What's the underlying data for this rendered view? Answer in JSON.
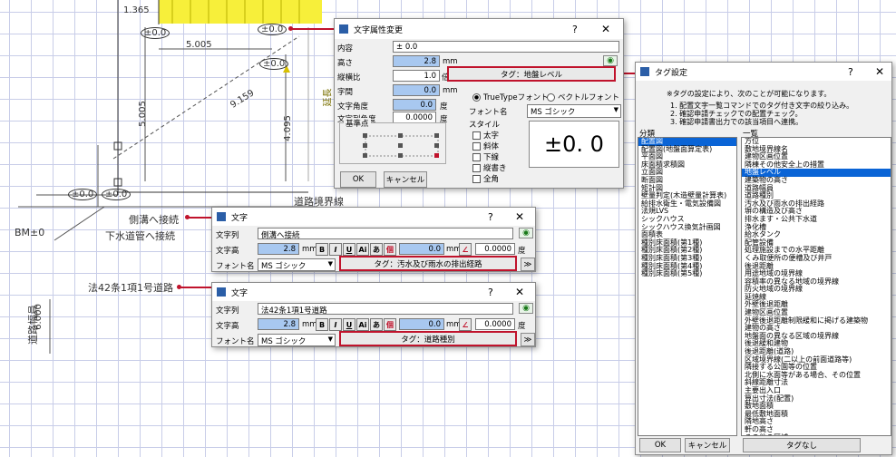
{
  "cad": {
    "texts": {
      "dim_top": "1.365",
      "pm_top": "±0.0",
      "pm_mid": "±0.0",
      "dim_5005": "5.005",
      "dim_5005v": "5.005",
      "dim_9159": "9.159",
      "dim_4095": "4.095",
      "pm_left1": "±0.0",
      "pm_left2": "±0.0",
      "road_boundary": "道路境界線",
      "side_ditch": "側溝へ接続",
      "sewer": "下水道管へ接続",
      "bm": "BM±0",
      "road_law": "法42条1項1号道路",
      "road_width_label": "道路幅員",
      "road_width_value": "6.000",
      "yellow_label1": "延長",
      "yellow_label2": "境"
    }
  },
  "main_dialog": {
    "title": "文字属性変更",
    "help": "?",
    "close": "✕",
    "content_label": "内容",
    "content_value": "± 0.0",
    "height_label": "高さ",
    "height_value": "2.8",
    "height_unit": "mm",
    "aspect_label": "縦横比",
    "aspect_value": "1.0",
    "aspect_unit": "倍",
    "spacing_label": "字間",
    "spacing_value": "0.0",
    "spacing_unit": "mm",
    "angle_label": "文字角度",
    "angle_value": "0.0",
    "angle_unit": "度",
    "line_angle_label": "文字列角度",
    "line_angle_value": "0.0000",
    "line_angle_unit": "度",
    "tag_button": "タグ：地盤レベル",
    "radio_truetype": "TrueTypeフォント",
    "radio_vector": "ベクトルフォント",
    "font_label": "フォント名",
    "font_value": "MS ゴシック",
    "ref_point_label": "基準点",
    "style_label": "スタイル",
    "style_bold": "太字",
    "style_italic": "斜体",
    "style_underline": "下線",
    "style_vertical": "縦書き",
    "style_fullwidth": "全角",
    "preview": "±0. 0",
    "ok": "OK",
    "cancel": "キャンセル"
  },
  "text_dialog1": {
    "title": "文字",
    "help": "?",
    "close": "✕",
    "string_label": "文字列",
    "string_value": "側溝へ接続",
    "height_label": "文字高",
    "height_value": "2.8",
    "unit": "mm",
    "fmt_bold": "B",
    "fmt_italic": "I",
    "fmt_underline": "U",
    "fmt_ai": "Ai",
    "fmt_a": "あ",
    "fmt_ab": "個",
    "spacing_value": "0.0",
    "angle_value": "0.0000",
    "angle_unit": "度",
    "font_label": "フォント名",
    "font_value": "MS ゴシック",
    "tag_button": "タグ：汚水及び雨水の排出経路",
    "expand": "≫"
  },
  "text_dialog2": {
    "title": "文字",
    "help": "?",
    "close": "✕",
    "string_label": "文字列",
    "string_value": "法42条1項1号道路",
    "height_label": "文字高",
    "height_value": "2.8",
    "unit": "mm",
    "fmt_bold": "B",
    "fmt_italic": "I",
    "fmt_underline": "U",
    "fmt_ai": "Ai",
    "fmt_a": "あ",
    "fmt_ab": "個",
    "spacing_value": "0.0",
    "angle_value": "0.0000",
    "angle_unit": "度",
    "font_label": "フォント名",
    "font_value": "MS ゴシック",
    "tag_button": "タグ：道路種別",
    "expand": "≫"
  },
  "tag_dialog": {
    "title": "タグ設定",
    "help": "?",
    "close": "✕",
    "note_title": "※タグの設定により、次のことが可能になります。",
    "note_1": "1. 配置文字一覧コマンドでのタグ付き文字の絞り込み。",
    "note_2": "2. 確認申請チェックでの配置チェック。",
    "note_3": "3. 確認申請書出力での該当項目へ連携。",
    "category_label": "分類",
    "list_label": "一覧",
    "categories": [
      "配置図",
      "配置図(地盤面算定表)",
      "平面図",
      "床面積求積図",
      "立面図",
      "断面図",
      "矩計図",
      "壁量判定(木造壁量計算表)",
      "給排水衛生・電気設備図",
      "法規LVS",
      "シックハウス",
      "シックハウス換気計画図",
      "面積表",
      "種別床面積(第1種)",
      "種別床面積(第2種)",
      "種別床面積(第3種)",
      "種別床面積(第4種)",
      "種別床面積(第5種)"
    ],
    "selected_category": 0,
    "items": [
      "方位",
      "敷地境界線名",
      "建物区画位置",
      "隣棟その他安全上の措置",
      "地盤レベル",
      "建築物の高さ",
      "道路幅員",
      "道路種別",
      "汚水及び雨水の排出経路",
      "塀の構造及び高さ",
      "排水ます・公共下水道",
      "浄化槽",
      "給水タンク",
      "配管設備",
      "処理施設までの水平距離",
      "くみ取便所の便槽及び井戸",
      "後退距離",
      "用途地域の境界線",
      "容積率の異なる地域の境界線",
      "防火地域の境界線",
      "延焼線",
      "外壁後退距離",
      "建物区画位置",
      "外壁後退距離制限緩和に掲げる建築物",
      "建物の高さ",
      "地盤面の異なる区域の境界線",
      "後退緩和建物",
      "後退距離(道路)",
      "区域境界線(二以上の前面道路等)",
      "隣接する公園等の位置",
      "北側に水面等がある場合、その位置",
      "斜線距離寸法",
      "主要出入口",
      "算出寸法(配置)",
      "敷地面積",
      "最低敷地面積",
      "隣地高さ",
      "軒の高さ",
      "その他の区域"
    ],
    "selected_item": 4,
    "ok": "OK",
    "cancel": "キャンセル",
    "no_tag": "タグなし"
  }
}
